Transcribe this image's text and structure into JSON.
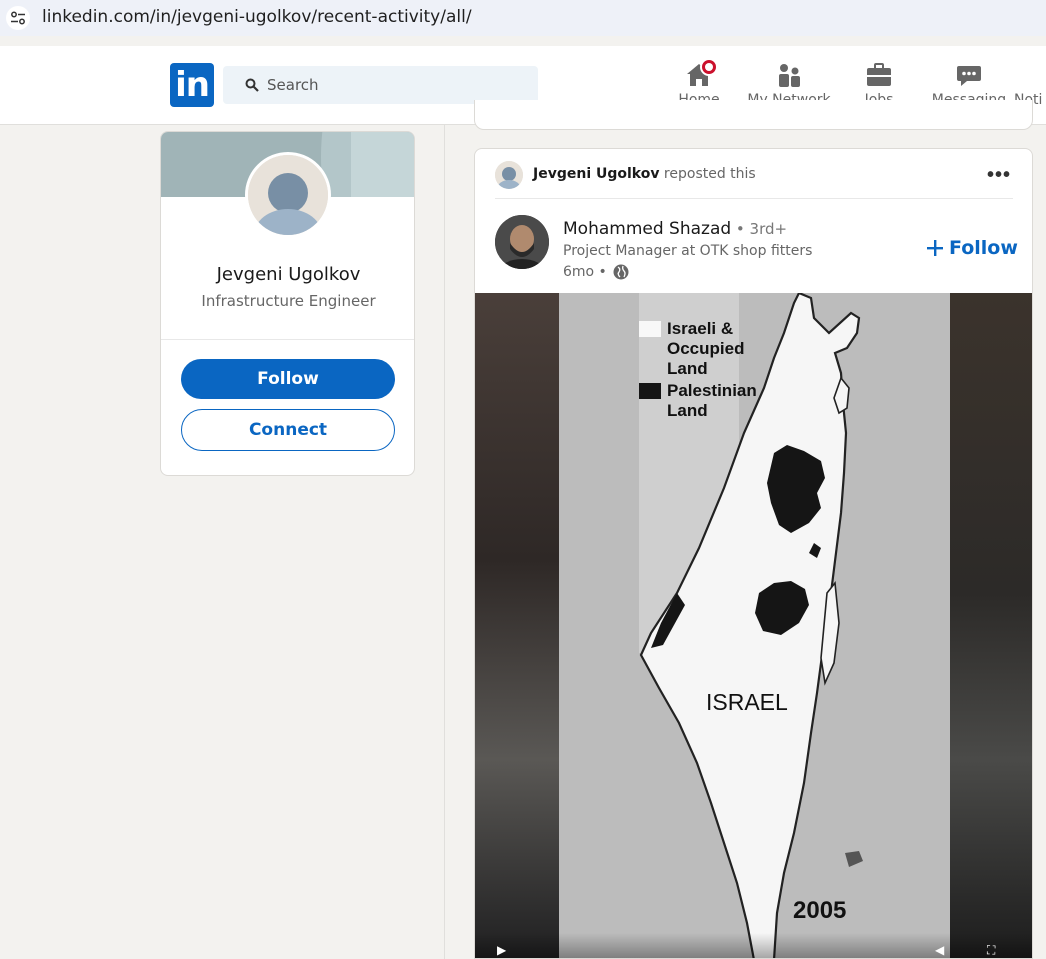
{
  "browser": {
    "url": "linkedin.com/in/jevgeni-ugolkov/recent-activity/all/"
  },
  "nav": {
    "logo_text": "in",
    "search_placeholder": "Search",
    "items": [
      {
        "label": "Home",
        "icon": "home-icon"
      },
      {
        "label": "My Network",
        "icon": "network-icon"
      },
      {
        "label": "Jobs",
        "icon": "briefcase-icon"
      },
      {
        "label": "Messaging",
        "icon": "messaging-icon"
      },
      {
        "label": "Noti",
        "icon": "bell-icon"
      }
    ]
  },
  "profile": {
    "name": "Jevgeni Ugolkov",
    "title": "Infrastructure Engineer",
    "follow_label": "Follow",
    "connect_label": "Connect"
  },
  "post": {
    "repost_name": "Jevgeni Ugolkov",
    "repost_suffix": " reposted this",
    "more_label": "•••",
    "author_name": "Mohammed Shazad",
    "author_degree": " • 3rd+",
    "author_headline": "Project Manager at OTK shop fitters",
    "time": "6mo •",
    "follow_label": "Follow",
    "media": {
      "legend": [
        {
          "text": "Israeli & Occupied Land",
          "lines": [
            "Israeli &",
            "Occupied",
            "Land"
          ]
        },
        {
          "text": "Palestinian Land",
          "lines": [
            "Palestinian",
            "Land"
          ]
        }
      ],
      "region_label": "ISRAEL",
      "year": "2005"
    }
  },
  "colors": {
    "brand": "#0a66c2",
    "badge": "#cb112d"
  }
}
